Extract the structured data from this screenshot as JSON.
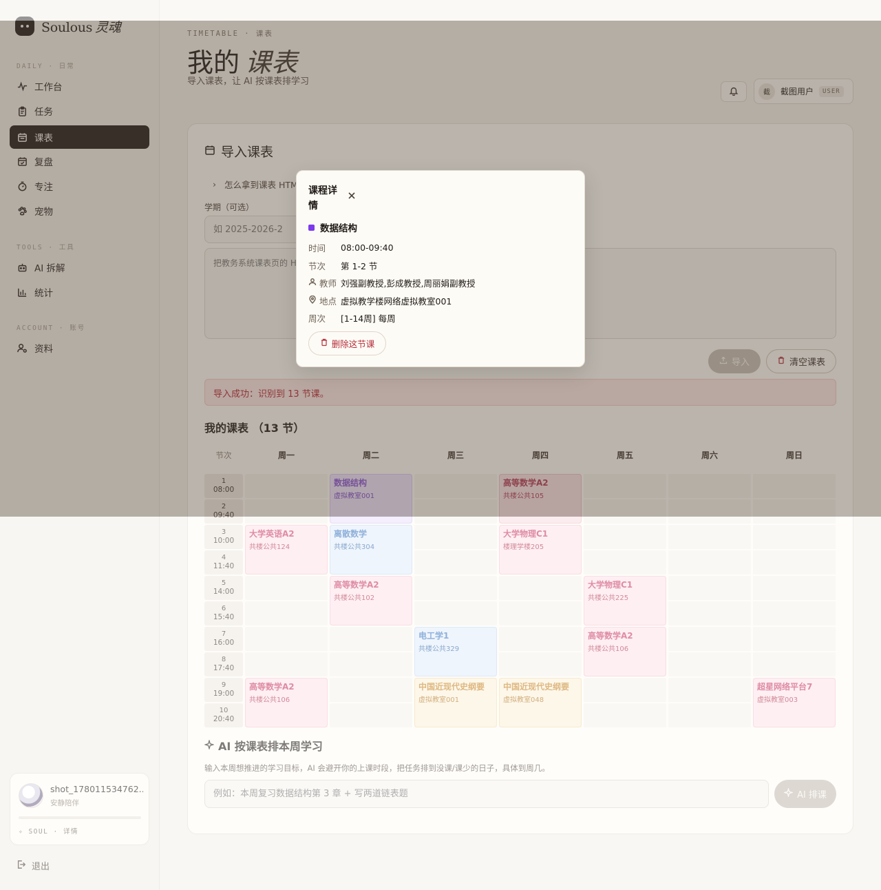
{
  "brand": {
    "name": "Soulous",
    "name_cn": "灵魂"
  },
  "sidebar": {
    "sections": [
      {
        "label": "DAILY · 日常"
      },
      {
        "label": "TOOLS · 工具"
      },
      {
        "label": "ACCOUNT · 账号"
      }
    ],
    "items": [
      {
        "label": "工作台",
        "icon": "pulse-icon"
      },
      {
        "label": "任务",
        "icon": "clipboard-icon"
      },
      {
        "label": "课表",
        "icon": "calendar-icon",
        "active": true
      },
      {
        "label": "复盘",
        "icon": "calendar-check-icon"
      },
      {
        "label": "专注",
        "icon": "timer-icon"
      },
      {
        "label": "宠物",
        "icon": "paw-icon"
      },
      {
        "label": "AI 拆解",
        "icon": "robot-icon"
      },
      {
        "label": "统计",
        "icon": "bar-chart-icon"
      },
      {
        "label": "资料",
        "icon": "user-gear-icon"
      }
    ],
    "soul": {
      "name": "shot_178011534762...",
      "status": "安静陪伴",
      "link": "SOUL · 详情",
      "progress": 0
    },
    "logout": "退出"
  },
  "header": {
    "crumb": "TIMETABLE · 课表",
    "title_a": "我的",
    "title_b": "课表",
    "subtitle": "导入课表，让 AI 按课表排学习",
    "user_avatar": "截",
    "user_name": "截图用户",
    "user_tag": "USER"
  },
  "import": {
    "title": "导入课表",
    "howto": "怎么拿到课表 HTML",
    "term_label": "学期（可选）",
    "term_placeholder": "如 2025-2026-2",
    "html_placeholder": "把教务系统课表页的 HTML 粘贴到这里",
    "import_btn": "导入",
    "clear_btn": "清空课表",
    "success": "导入成功：识别到 13 节课。"
  },
  "schedule": {
    "title": "我的课表 （13 节）",
    "node_header": "节次",
    "days": [
      "周一",
      "周二",
      "周三",
      "周四",
      "周五",
      "周六",
      "周日"
    ],
    "slots": [
      {
        "n": "1",
        "t": "08:00"
      },
      {
        "n": "2",
        "t": "09:40"
      },
      {
        "n": "3",
        "t": "10:00"
      },
      {
        "n": "4",
        "t": "11:40"
      },
      {
        "n": "5",
        "t": "14:00"
      },
      {
        "n": "6",
        "t": "15:40"
      },
      {
        "n": "7",
        "t": "16:00"
      },
      {
        "n": "8",
        "t": "17:40"
      },
      {
        "n": "9",
        "t": "19:00"
      },
      {
        "n": "10",
        "t": "20:40"
      }
    ],
    "courses": [
      {
        "day": 1,
        "start": 1,
        "name": "数据结构",
        "room": "虚拟教室001",
        "color": "purple"
      },
      {
        "day": 3,
        "start": 1,
        "name": "高等数学A2",
        "room": "共楼公共105",
        "color": "cherry"
      },
      {
        "day": 0,
        "start": 3,
        "name": "大学英语A2",
        "room": "共楼公共124",
        "color": "pink"
      },
      {
        "day": 1,
        "start": 3,
        "name": "离散数学",
        "room": "共楼公共304",
        "color": "blue"
      },
      {
        "day": 3,
        "start": 3,
        "name": "大学物理C1",
        "room": "楼理学楼205",
        "color": "pink"
      },
      {
        "day": 1,
        "start": 5,
        "name": "高等数学A2",
        "room": "共楼公共102",
        "color": "pink"
      },
      {
        "day": 4,
        "start": 5,
        "name": "大学物理C1",
        "room": "共楼公共225",
        "color": "pink"
      },
      {
        "day": 2,
        "start": 7,
        "name": "电工学1",
        "room": "共楼公共329",
        "color": "blue"
      },
      {
        "day": 4,
        "start": 7,
        "name": "高等数学A2",
        "room": "共楼公共106",
        "color": "pink"
      },
      {
        "day": 0,
        "start": 9,
        "name": "高等数学A2",
        "room": "共楼公共106",
        "color": "pink"
      },
      {
        "day": 2,
        "start": 9,
        "name": "中国近现代史纲要",
        "room": "虚拟教室001",
        "color": "yellow"
      },
      {
        "day": 3,
        "start": 9,
        "name": "中国近现代史纲要",
        "room": "虚拟教室048",
        "color": "yellow"
      },
      {
        "day": 6,
        "start": 9,
        "name": "超星网络平台7",
        "room": "虚拟教室003",
        "color": "pink"
      }
    ]
  },
  "ai": {
    "title": "AI 按课表排本周学习",
    "desc": "输入本周想推进的学习目标，AI 会避开你的上课时段，把任务排到没课/课少的日子，具体到周几。",
    "placeholder": "例如：本周复习数据结构第 3 章 + 写两道链表题",
    "btn": "AI 排课"
  },
  "modal": {
    "title": "课程详情",
    "course": "数据结构",
    "dot_color": "#7c3aed",
    "rows": [
      {
        "key": "时间",
        "val": "08:00-09:40"
      },
      {
        "key": "节次",
        "val": "第 1-2 节"
      },
      {
        "key": "教师",
        "val": "刘强副教授,彭成教授,周丽娟副教授"
      },
      {
        "key": "地点",
        "val": "虚拟教学楼网络虚拟教室001"
      },
      {
        "key": "周次",
        "val": "[1-14周] 每周"
      }
    ],
    "delete_btn": "删除这节课"
  }
}
